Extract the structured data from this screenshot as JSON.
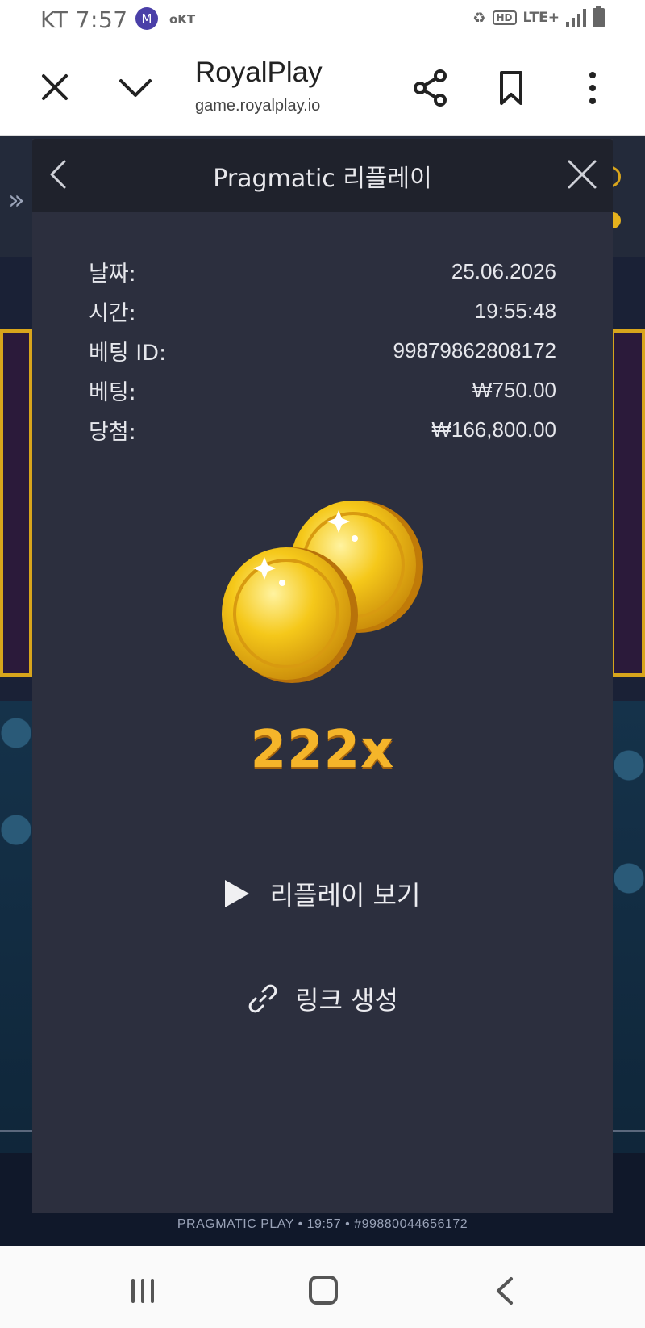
{
  "status_bar": {
    "time": "KT 7:57",
    "app_badge": "M",
    "carrier_icon_text": "oKT",
    "hd": "HD",
    "network": "LTE+"
  },
  "browser": {
    "title": "RoyalPlay",
    "url": "game.royalplay.io"
  },
  "modal": {
    "title": "Pragmatic 리플레이",
    "rows": [
      {
        "label": "날짜:",
        "value": "25.06.2026"
      },
      {
        "label": "시간:",
        "value": "19:55:48"
      },
      {
        "label": "베팅 ID:",
        "value": "99879862808172"
      },
      {
        "label": "베팅:",
        "value": "₩750.00"
      },
      {
        "label": "당첨:",
        "value": "₩166,800.00"
      }
    ],
    "multiplier": "222x",
    "replay_label": "리플레이 보기",
    "link_label": "링크 생성"
  },
  "game_footer": "PRAGMATIC PLAY • 19:57 • #99880044656172",
  "icons": {
    "back": "chevron-left-icon",
    "close": "close-icon",
    "play": "play-icon",
    "link": "link-icon",
    "share": "share-icon",
    "bookmark": "bookmark-icon",
    "more": "more-vertical-icon"
  },
  "colors": {
    "modal_bg": "#2c2f3e",
    "modal_header_bg": "#1f222c",
    "multiplier": "#f5b52a",
    "coin": "#f2c21b"
  }
}
